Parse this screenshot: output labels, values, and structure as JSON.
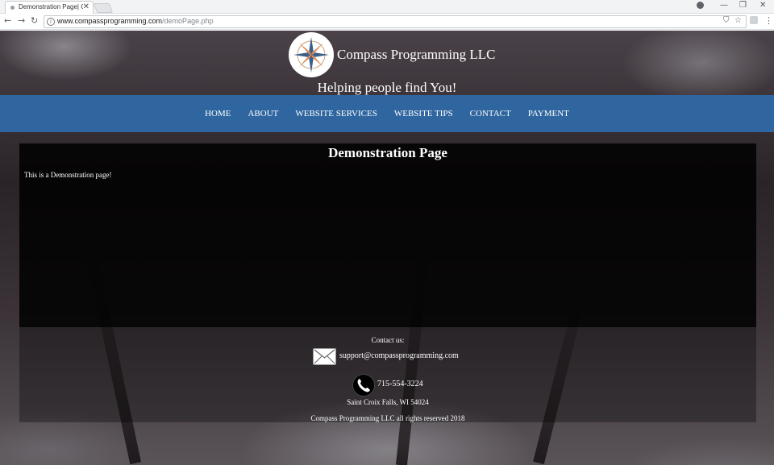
{
  "browser": {
    "tab_title": "Demonstration Page| Cor",
    "tab_close": "✕",
    "url_host": "www.compassprogramming.com",
    "url_path": "/demoPage.php",
    "info_icon": "i",
    "back": "←",
    "forward": "→",
    "reload": "↻",
    "star": "☆",
    "translate": "⛉",
    "menu": "⋮",
    "minimize": "—",
    "restore": "❐",
    "close": "✕"
  },
  "header": {
    "site_name": "Compass Programming LLC",
    "tagline": "Helping people find You!"
  },
  "nav": {
    "items": [
      "HOME",
      "ABOUT",
      "WEBSITE SERVICES",
      "WEBSITE TIPS",
      "CONTACT",
      "PAYMENT"
    ]
  },
  "main": {
    "heading": "Demonstration Page",
    "text": "This is a Demonstration page!"
  },
  "footer": {
    "contact_label": "Contact us:",
    "email": "support@compassprogramming.com",
    "phone": "715-554-3224",
    "address": "Saint Croix Falls, WI 54024",
    "copyright": "Compass Programming LLC all rights reserved 2018"
  },
  "colors": {
    "nav_bar": "#2f66a0",
    "content_overlay": "#000000",
    "text": "#ffffff"
  }
}
